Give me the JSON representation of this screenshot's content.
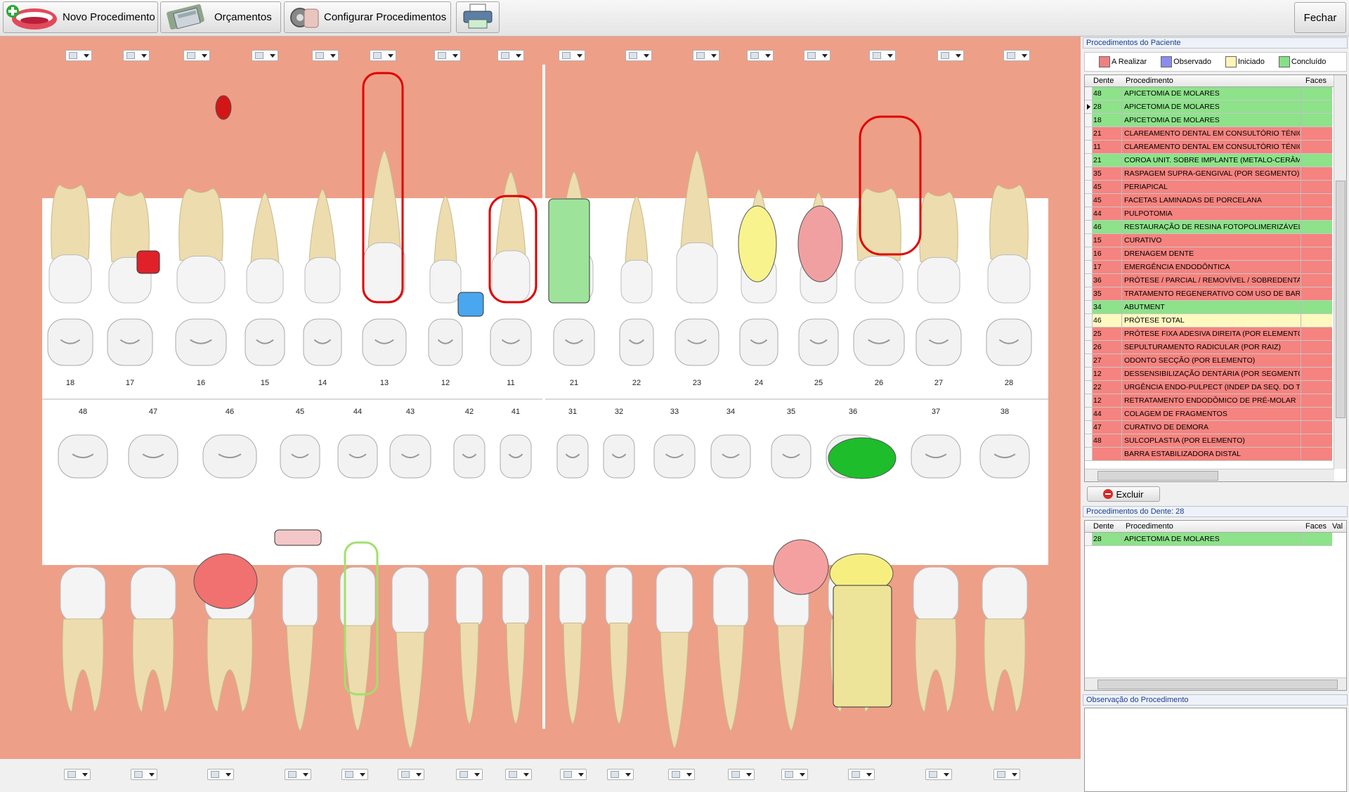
{
  "toolbar": {
    "new_label": "Novo Procedimento",
    "budget_label": "Orçamentos",
    "config_label": "Configurar Procedimentos",
    "close_label": "Fechar"
  },
  "upper_teeth": [
    "18",
    "17",
    "16",
    "15",
    "14",
    "13",
    "12",
    "11",
    "21",
    "22",
    "23",
    "24",
    "25",
    "26",
    "27",
    "28"
  ],
  "lower_teeth": [
    "48",
    "47",
    "46",
    "45",
    "44",
    "43",
    "42",
    "41",
    "31",
    "32",
    "33",
    "34",
    "35",
    "36",
    "37",
    "38"
  ],
  "patient_panel": {
    "title": "Procedimentos do Paciente",
    "legend": [
      {
        "label": "A Realizar",
        "color": "#f08080"
      },
      {
        "label": "Observado",
        "color": "#8c8cf0"
      },
      {
        "label": "Iniciado",
        "color": "#fdf5b8"
      },
      {
        "label": "Concluído",
        "color": "#86e086"
      }
    ],
    "columns": {
      "tooth": "Dente",
      "procedure": "Procedimento",
      "faces": "Faces"
    },
    "rows": [
      {
        "tooth": "48",
        "procedure": "APICETOMIA DE MOLARES",
        "status": "green"
      },
      {
        "tooth": "28",
        "procedure": "APICETOMIA DE MOLARES",
        "status": "green",
        "current": true
      },
      {
        "tooth": "18",
        "procedure": "APICETOMIA DE MOLARES",
        "status": "green"
      },
      {
        "tooth": "21",
        "procedure": "CLAREAMENTO DENTAL EM CONSULTÓRIO TÉNICA",
        "status": "red"
      },
      {
        "tooth": "11",
        "procedure": "CLAREAMENTO DENTAL EM CONSULTÓRIO TÉNICA",
        "status": "red"
      },
      {
        "tooth": "21",
        "procedure": "COROA UNIT. SOBRE IMPLANTE (METALO-CERÂMI",
        "status": "green"
      },
      {
        "tooth": "35",
        "procedure": "RASPAGEM SUPRA-GENGIVAL (POR SEGMENTO)",
        "status": "red"
      },
      {
        "tooth": "45",
        "procedure": "PERIAPICAL",
        "status": "red"
      },
      {
        "tooth": "45",
        "procedure": "FACETAS LAMINADAS DE PORCELANA",
        "status": "red"
      },
      {
        "tooth": "44",
        "procedure": "PULPOTOMIA",
        "status": "red"
      },
      {
        "tooth": "46",
        "procedure": "RESTAURAÇÃO DE RESINA FOTOPOLIMERIZÁVEL - MOVDL",
        "status": "green"
      },
      {
        "tooth": "15",
        "procedure": "CURATIVO",
        "status": "red"
      },
      {
        "tooth": "16",
        "procedure": "DRENAGEM DENTE",
        "status": "red"
      },
      {
        "tooth": "17",
        "procedure": "EMERGÊNCIA ENDODÔNTICA",
        "status": "red"
      },
      {
        "tooth": "36",
        "procedure": "PRÓTESE / PARCIAL / REMOVÍVEL / SOBREDENTAD",
        "status": "red"
      },
      {
        "tooth": "35",
        "procedure": "TRATAMENTO REGENERATIVO COM USO DE BARRI",
        "status": "red"
      },
      {
        "tooth": "34",
        "procedure": "ABUTMENT",
        "status": "green"
      },
      {
        "tooth": "46",
        "procedure": "PRÓTESE TOTAL",
        "status": "yellow"
      },
      {
        "tooth": "25",
        "procedure": "PRÓTESE FIXA ADESIVA DIREITA (POR ELEMENTO)",
        "status": "red"
      },
      {
        "tooth": "26",
        "procedure": "SEPULTURAMENTO RADICULAR (POR RAIZ)",
        "status": "red"
      },
      {
        "tooth": "27",
        "procedure": "ODONTO SECÇÃO (POR ELEMENTO)",
        "status": "red"
      },
      {
        "tooth": "12",
        "procedure": "DESSENSIBILIZAÇÃO DENTÁRIA (POR SEGMENTO)",
        "status": "red"
      },
      {
        "tooth": "22",
        "procedure": "URGÊNCIA ENDO-PULPECT (INDEP DA SEQ. DO TR.",
        "status": "red"
      },
      {
        "tooth": "12",
        "procedure": "RETRATAMENTO ENDODÔMICO DE PRÉ-MOLAR",
        "status": "red"
      },
      {
        "tooth": "44",
        "procedure": "COLAGEM DE FRAGMENTOS",
        "status": "red"
      },
      {
        "tooth": "47",
        "procedure": "CURATIVO DE DEMORA",
        "status": "red"
      },
      {
        "tooth": "48",
        "procedure": "SULCOPLASTIA (POR ELEMENTO)",
        "status": "red"
      },
      {
        "tooth": "",
        "procedure": "BARRA ESTABILIZADORA DISTAL",
        "status": "red"
      }
    ],
    "delete_label": "Excluir"
  },
  "tooth_panel": {
    "title": "Procedimentos do Dente: 28",
    "columns": {
      "tooth": "Dente",
      "procedure": "Procedimento",
      "faces": "Faces",
      "value": "Val"
    },
    "rows": [
      {
        "tooth": "28",
        "procedure": "APICETOMIA DE MOLARES",
        "status": "green"
      }
    ]
  },
  "obs_panel": {
    "title": "Observação do Procedimento",
    "text": ""
  }
}
